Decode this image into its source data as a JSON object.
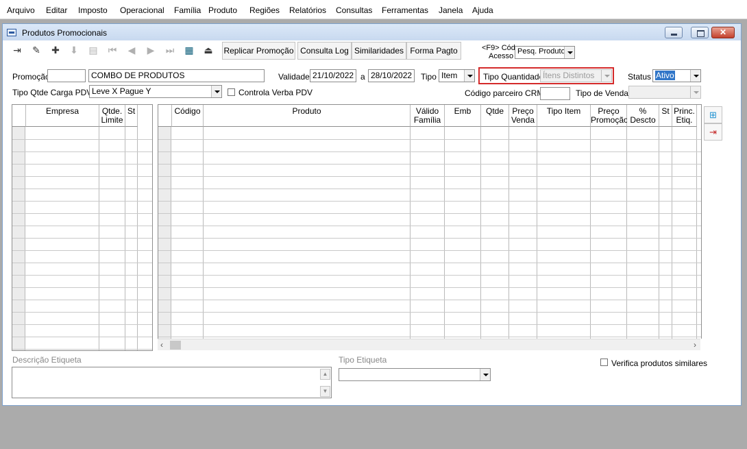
{
  "menu": [
    "Arquivo",
    "Editar",
    "Imposto",
    "Operacional",
    "Família",
    "Produto",
    "Regiões",
    "Relatórios",
    "Consultas",
    "Ferramentas",
    "Janela",
    "Ajuda"
  ],
  "window": {
    "title": "Produtos Promocionais",
    "close_label": "✕"
  },
  "toolbar": {
    "icons": [
      "exit-icon",
      "edit-icon",
      "add-icon",
      "save-icon",
      "print-icon",
      "first-icon",
      "prev-icon",
      "next-icon",
      "last-icon",
      "grid-icon",
      "export-icon"
    ],
    "buttons": [
      "Replicar Promoção",
      "Consulta Log",
      "Similaridades",
      "Forma Pagto"
    ],
    "f9_label_line1": "<F9> Cód",
    "f9_label_line2": "Acesso",
    "search_select": "Pesq. Produto"
  },
  "form": {
    "promocao_label": "Promoção",
    "promocao_code": "",
    "promocao_desc": "COMBO DE PRODUTOS",
    "validade_label": "Validade",
    "validade_start": "21/10/2022",
    "a_label": "a",
    "validade_end": "28/10/2022",
    "tipo_label": "Tipo",
    "tipo_value": "Item",
    "tipo_qtde_label": "Tipo Quantidade",
    "tipo_qtde_value": "Ítens Distintos",
    "status_label": "Status",
    "status_value": "Ativo",
    "carga_label": "Tipo Qtde Carga PDV",
    "carga_value": "Leve X Pague Y",
    "verba_label": "Controla Verba PDV",
    "crm_label": "Código parceiro CRM",
    "crm_value": "",
    "tipo_venda_label": "Tipo de Venda",
    "tipo_venda_value": ""
  },
  "grid_empresa": {
    "headers": [
      "Empresa",
      "Qtde. Limite",
      "St"
    ]
  },
  "grid_produto": {
    "headers": [
      "Código",
      "Produto",
      "Válido Família",
      "Emb",
      "Qtde",
      "Preço Venda",
      "Tipo Item",
      "Preço Promoção",
      "% Descto",
      "St",
      "Princ. Etiq."
    ]
  },
  "bottom": {
    "descricao_label": "Descrição Etiqueta",
    "descricao_value": "",
    "tipo_etiqueta_label": "Tipo Etiqueta",
    "tipo_etiqueta_value": "",
    "similares_label": "Verifica produtos similares"
  },
  "colors": {
    "accent": "#3176c8",
    "highlight": "#d42a2a",
    "background": "#ababab"
  }
}
